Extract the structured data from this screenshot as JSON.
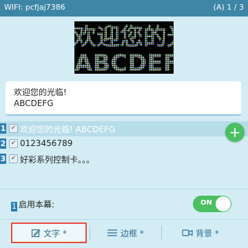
{
  "status_bar": {
    "wifi": "WIFI: pcfjaj7386",
    "page": "(A) 1 / 3"
  },
  "editor": {
    "line1": "欢迎您的光临!",
    "line2": "ABCDEFG"
  },
  "items": [
    {
      "num": "1",
      "text": "欢迎您的光临!  ABCDEFG"
    },
    {
      "num": "2",
      "text": "0123456789"
    },
    {
      "num": "3",
      "text": "好彩系列控制卡。。。"
    }
  ],
  "fab": {
    "label": "+"
  },
  "enable": {
    "num": "1",
    "label": "启用本幕:"
  },
  "toggle": {
    "label": "ON",
    "state": "on"
  },
  "tabs": [
    {
      "label": "文字 *",
      "icon": "edit-icon"
    },
    {
      "label": "边框 *",
      "icon": "lines-icon"
    },
    {
      "label": "背景 *",
      "icon": "video-icon"
    }
  ],
  "colors": {
    "status_bar": "#3d86a6",
    "accent_green": "#4bbf62",
    "active_outline": "#e84a3b",
    "background": "#d4edf5"
  }
}
